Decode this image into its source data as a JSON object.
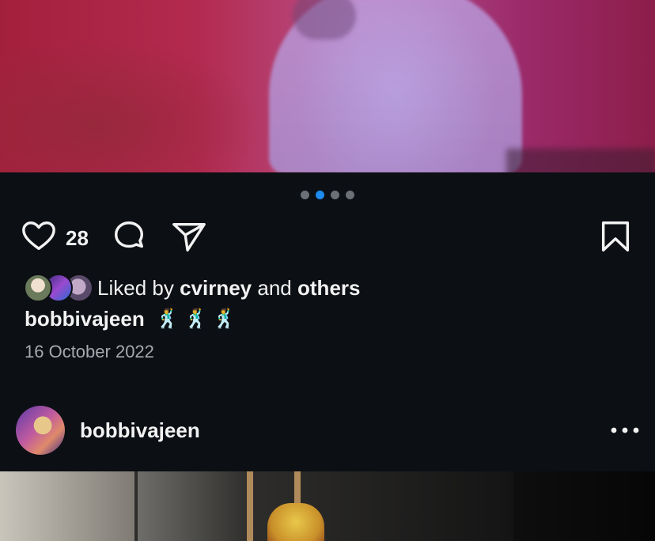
{
  "post": {
    "carousel": {
      "count": 4,
      "active_index": 1
    },
    "actions": {
      "like_icon": "heart-icon",
      "like_count": "28",
      "comment_icon": "comment-icon",
      "share_icon": "paper-plane-icon",
      "save_icon": "bookmark-icon"
    },
    "liked_by": {
      "prefix": "Liked by",
      "user": "cvirney",
      "conjunction": "and",
      "others": "others"
    },
    "caption": {
      "username": "bobbivajeen",
      "text": "🕺🕺🕺"
    },
    "date": "16 October 2022"
  },
  "next_post": {
    "username": "bobbivajeen",
    "more_icon": "more-dots-icon"
  },
  "colors": {
    "background": "#0c0f14",
    "active_dot": "#1d8cf0",
    "inactive_dot": "#6b6f76",
    "muted_text": "#a6a9ae"
  }
}
